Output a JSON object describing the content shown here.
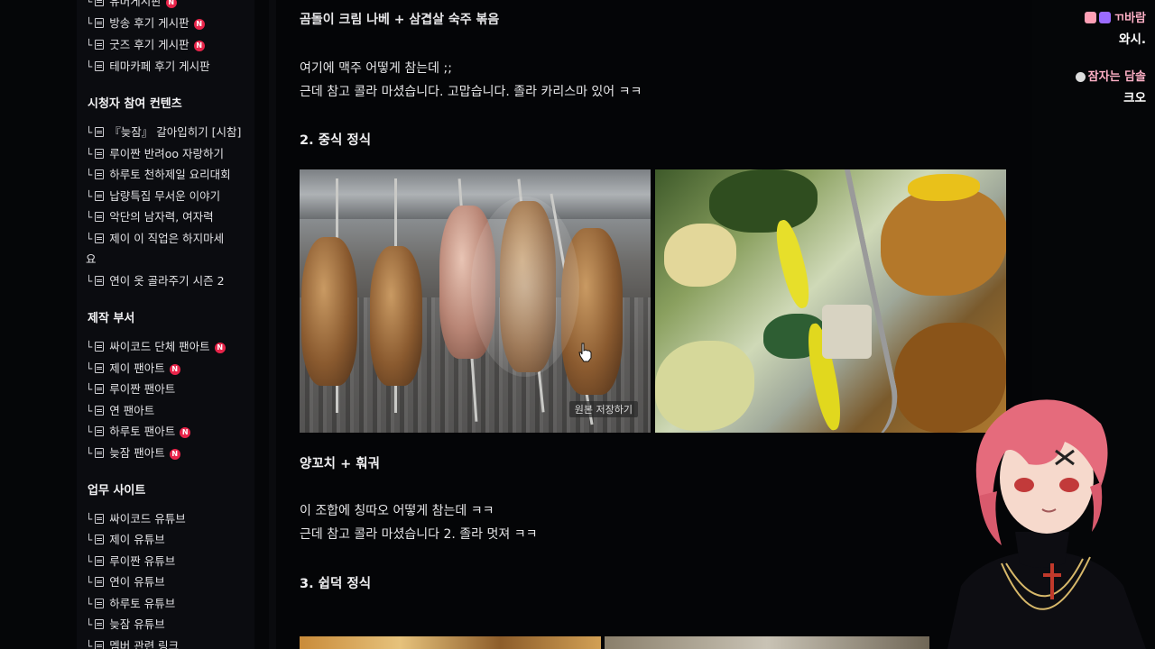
{
  "sidebar": {
    "top_items": [
      {
        "label": "유머게시판",
        "badge": "N"
      },
      {
        "label": "방송 후기 게시판",
        "badge": "N"
      },
      {
        "label": "굿즈 후기 게시판",
        "badge": "N"
      },
      {
        "label": "테마카페 후기 게시판",
        "badge": ""
      }
    ],
    "sections": [
      {
        "title": "시청자 참여 컨텐츠",
        "items": [
          {
            "label": "『늦잠』 갈아입히기 [시참]",
            "badge": ""
          },
          {
            "label": "루이짠 반려oo 자랑하기",
            "badge": ""
          },
          {
            "label": "하루토 천하제일 요리대회",
            "badge": ""
          },
          {
            "label": "납량특집 무서운 이야기",
            "badge": ""
          },
          {
            "label": "악단의 남자력, 여자력",
            "badge": ""
          },
          {
            "label": "제이 이 직업은 하지마세",
            "badge": ""
          },
          {
            "label": "요",
            "badge": ""
          },
          {
            "label": "연이 옷 골라주기 시즌 2",
            "badge": ""
          }
        ]
      },
      {
        "title": "제작 부서",
        "items": [
          {
            "label": "싸이코드 단체 팬아트",
            "badge": "N"
          },
          {
            "label": "제이 팬아트",
            "badge": "N"
          },
          {
            "label": "루이짠 팬아트",
            "badge": ""
          },
          {
            "label": "연 팬아트",
            "badge": ""
          },
          {
            "label": "하루토 팬아트",
            "badge": "N"
          },
          {
            "label": "늦잠 팬아트",
            "badge": "N"
          }
        ]
      },
      {
        "title": "업무 사이트",
        "items": [
          {
            "label": "싸이코드 유튜브",
            "badge": ""
          },
          {
            "label": "제이 유튜브",
            "badge": ""
          },
          {
            "label": "루이짠 유튜브",
            "badge": ""
          },
          {
            "label": "연이 유튜브",
            "badge": ""
          },
          {
            "label": "하루토 유튜브",
            "badge": ""
          },
          {
            "label": "늦잠 유튜브",
            "badge": ""
          },
          {
            "label": "멤버 관련 링크",
            "badge": ""
          }
        ]
      }
    ]
  },
  "post": {
    "line1": "곰돌이 크림 나베 + 삼겹살 숙주 볶음",
    "line2": "여기에 맥주 어떻게 참는데 ;;",
    "line3": "근데 참고 콜라 마셨습니다. 고맙습니다.  졸라 카리스마 있어 ㅋㅋ",
    "heading2": "2. 중식 정식",
    "save_label": "원본 저장하기",
    "caption2": "양꼬치 + 훠궈",
    "line4": "이 조합에 칭따오 어떻게 참는데 ㅋㅋ",
    "line5": "근데 참고 콜라 마셨습니다 2. 졸라 멋져 ㅋㅋ",
    "heading3": "3. 쉽덕 정식"
  },
  "chat": [
    {
      "name": "ㄲ바람",
      "message": "와시.",
      "icon": "heart-badge-icon",
      "color": "#ffb0c6"
    },
    {
      "name": "잠자는 담솔",
      "message": "크오",
      "icon": "pill-icon",
      "color": "#ffb0c6"
    }
  ],
  "colors": {
    "background": "#050608",
    "sidebar": "#0b0c10",
    "badge": "#e8254a",
    "text": "#e6e6e8"
  }
}
